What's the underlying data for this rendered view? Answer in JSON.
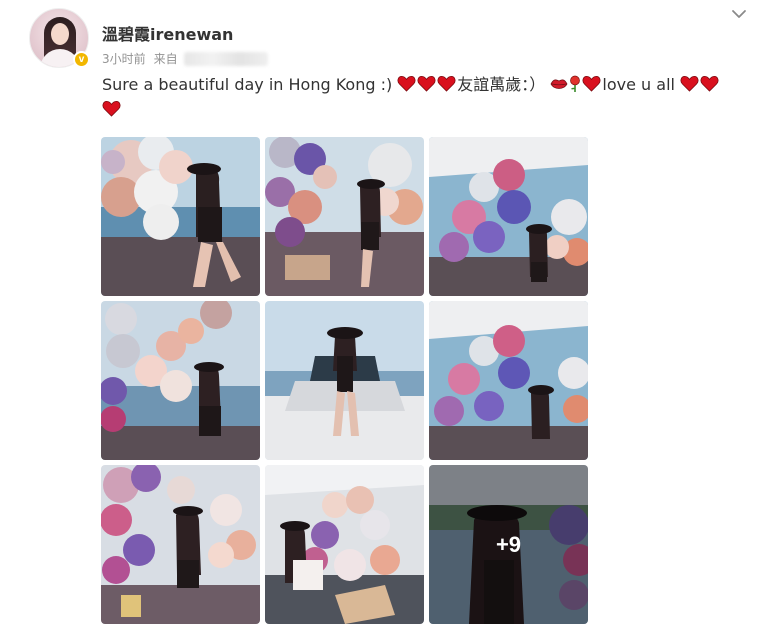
{
  "post": {
    "username": "溫碧霞irenewan",
    "verified_badge": "v",
    "time": "3小时前",
    "from_label": "来自",
    "text_line1_a": "Sure a beautiful day in Hong Kong :)",
    "text_line1_b": "友誼萬歲：）",
    "text_line1_c": "love u all",
    "more_count": "+9",
    "colors": {
      "heart": "#d9101e",
      "badge": "#f2b700",
      "meta": "#939393",
      "text": "#333333"
    },
    "icons": [
      "chevron-down-icon",
      "heart-icon",
      "lips-icon",
      "rose-icon",
      "verified-icon"
    ]
  }
}
